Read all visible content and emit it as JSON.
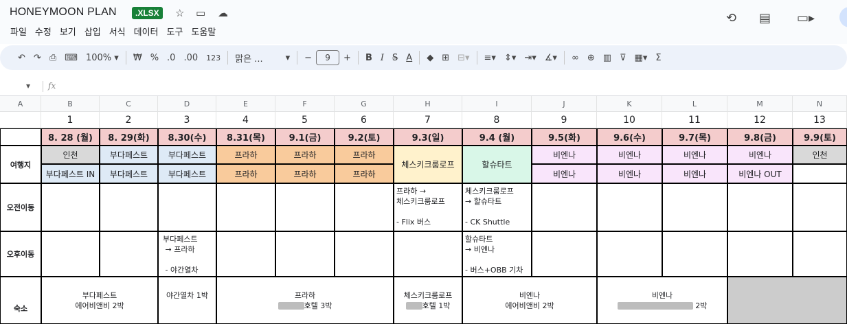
{
  "doc": {
    "title": "HONEYMOON PLAN",
    "badge": ".XLSX"
  },
  "menu": [
    "파일",
    "수정",
    "보기",
    "삽입",
    "서식",
    "데이터",
    "도구",
    "도움말"
  ],
  "toolbar": {
    "zoom": "100%",
    "currency": "₩",
    "percent": "%",
    "dec_dec": ".0",
    "dec_inc": ".00",
    "num_format": "123",
    "font": "맑은 ...",
    "font_size": "9"
  },
  "formula": {
    "fx": "fx"
  },
  "colors": {
    "pink": "#f4cccc",
    "gray": "#d9d9d9",
    "blue": "#deeaf6",
    "orange": "#f9cb9c",
    "yellow": "#fff2cc",
    "mint": "#d9f7e8",
    "lavender": "#f9e5fb",
    "darkgray": "#cccccc"
  },
  "columns": [
    "A",
    "B",
    "C",
    "D",
    "E",
    "F",
    "G",
    "H",
    "I",
    "J",
    "K",
    "L",
    "M",
    "N"
  ],
  "days": [
    "1",
    "2",
    "3",
    "4",
    "5",
    "6",
    "7",
    "8",
    "9",
    "10",
    "11",
    "12",
    "13"
  ],
  "dates": [
    "8. 28 (월)",
    "8. 29(화)",
    "8.30(수)",
    "8.31(목)",
    "9.1(금)",
    "9.2(토)",
    "9.3(일)",
    "9.4 (월)",
    "9.5(화)",
    "9.6(수)",
    "9.7(목)",
    "9.8(금)",
    "9.9(토)"
  ],
  "labels": {
    "dest": "여행지",
    "am": "오전이동",
    "pm": "오후이동",
    "stay": "숙소"
  },
  "dest_row1": [
    "인천",
    "부다페스트",
    "부다페스트",
    "프라하",
    "프라하",
    "프라하",
    "체스키크룸로프",
    "할슈타트",
    "비엔나",
    "비엔나",
    "비엔나",
    "비엔나",
    "인천"
  ],
  "dest_row2": [
    "부다페스트 IN",
    "부다페스트",
    "부다페스트",
    "프라하",
    "프라하",
    "프라하",
    "",
    "",
    "비엔나",
    "비엔나",
    "비엔나",
    "비엔나 OUT",
    ""
  ],
  "am_move": {
    "h": "프라하 →\n체스키크룸로프\n\n- Flix 버스",
    "i": "체스키크룸로프\n→ 할슈타트\n\n- CK Shuttle"
  },
  "pm_move": {
    "d": "부다페스트\n → 프라하\n\n - 야간열차",
    "i": "할슈타트\n→ 비엔나\n\n- 버스+OBB 기차"
  },
  "stay": {
    "bc": "부다페스트\n에어비앤비 2박",
    "d": "야간열차 1박",
    "efg_top": "프라하",
    "efg_bottom": "호텔 3박",
    "h_top": "체스키크룸로프",
    "h_bottom": "호텔 1박",
    "ij": "비엔나\n에어비앤비 2박",
    "kl_top": "비엔나",
    "kl_bottom": "2박"
  }
}
